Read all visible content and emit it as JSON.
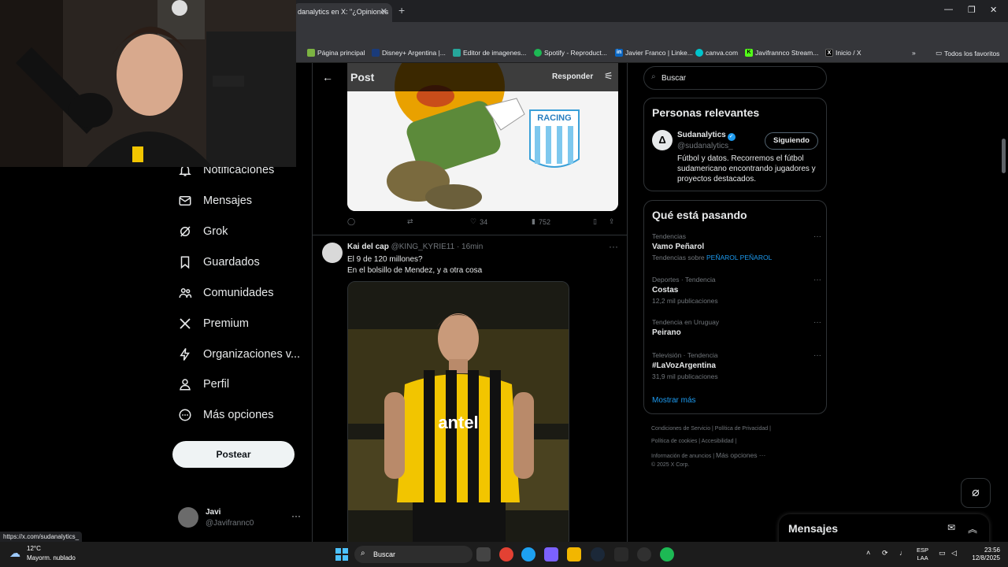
{
  "browser": {
    "tab_title": "danalytics en X: \"¿Opiniones",
    "tab_close": "✕",
    "new_tab": "+",
    "bookmarks": [
      {
        "label": "Página principal"
      },
      {
        "label": "Disney+ Argentina |..."
      },
      {
        "label": "Editor de imagenes..."
      },
      {
        "label": "Spotify - Reproduct..."
      },
      {
        "label": "Javier Franco | Linke..."
      },
      {
        "label": "canva.com"
      },
      {
        "label": "Javifrannco Stream..."
      },
      {
        "label": "Inicio / X"
      }
    ],
    "all_bookmarks": "Todos los favoritos",
    "status_url": "https://x.com/sudanalytics_"
  },
  "nav": {
    "items": [
      {
        "label": "Notificaciones"
      },
      {
        "label": "Mensajes"
      },
      {
        "label": "Grok"
      },
      {
        "label": "Guardados"
      },
      {
        "label": "Comunidades"
      },
      {
        "label": "Premium"
      },
      {
        "label": "Organizaciones v..."
      },
      {
        "label": "Perfil"
      },
      {
        "label": "Más opciones"
      }
    ],
    "post_button": "Postear",
    "user": {
      "name": "Javi",
      "handle": "@Javifrannc0"
    }
  },
  "center": {
    "header_title": "Post",
    "reply_label": "Responder",
    "prev_post": {
      "media_text": "RACING",
      "likes": "34",
      "views": "752"
    },
    "tweet": {
      "name": "Kai del cap",
      "handle": "@KING_KYRIE11",
      "time": "· 16min",
      "line1": "El 9 de 120 millones?",
      "line2": "En el bolsillo de Mendez, y a otra cosa",
      "shirt_text": "antel"
    }
  },
  "right": {
    "search_placeholder": "Buscar",
    "relevant": {
      "title": "Personas relevantes",
      "name": "Sudanalytics",
      "handle": "@sudanalytics_",
      "follow_label": "Siguiendo",
      "bio": "Fútbol y datos. Recorremos el fútbol sudamericano encontrando jugadores y proyectos destacados."
    },
    "trends": {
      "title": "Qué está pasando",
      "items": [
        {
          "category": "Tendencias",
          "name": "Vamo Peñarol",
          "sub_prefix": "Tendencias sobre ",
          "sub_link": "PEÑAROL PEÑAROL"
        },
        {
          "category": "Deportes · Tendencia",
          "name": "Costas",
          "sub": "12,2 mil publicaciones"
        },
        {
          "category": "Tendencia en Uruguay",
          "name": "Peirano",
          "sub": ""
        },
        {
          "category": "Televisión · Tendencia",
          "name": "#LaVozArgentina",
          "sub": "31,9 mil publicaciones"
        }
      ],
      "show_more": "Mostrar más"
    },
    "footer": {
      "row1": "Condiciones de Servicio  |  Política de Privacidad  |",
      "row2": "Política de cookies  |  Accesibilidad  |",
      "row3a": "Información de anuncios  |",
      "row3b": "Más opciones ···",
      "row4": "© 2025 X Corp."
    },
    "messages_title": "Mensajes"
  },
  "taskbar": {
    "temp": "12°C",
    "condition": "Mayorm. nublado",
    "search": "Buscar",
    "lang1": "ESP",
    "lang2": "LAA",
    "time": "23:56",
    "date": "12/8/2025"
  },
  "colors": {
    "accent": "#1d9bf0",
    "background": "#000000",
    "penarol_yellow": "#f2c500"
  }
}
